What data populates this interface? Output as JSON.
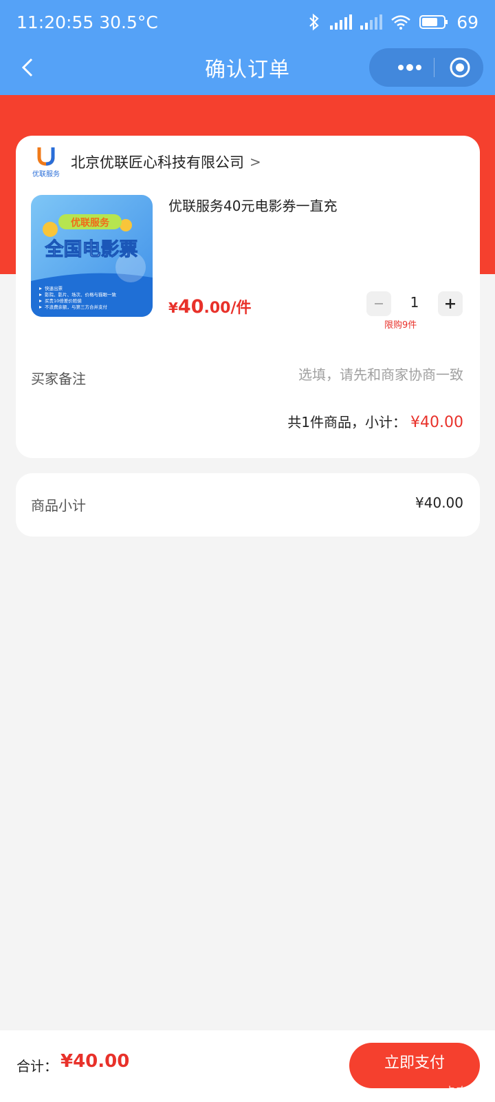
{
  "status_bar": {
    "time": "11:20:55",
    "temperature": "30.5°C",
    "battery": "69"
  },
  "nav": {
    "title": "确认订单"
  },
  "shop": {
    "logo_text": "优联服务",
    "name": "北京优联匠心科技有限公司",
    "chevron": ">"
  },
  "product": {
    "title": "优联服务40元电影券一直充",
    "price_currency": "¥",
    "price_int": "40",
    "price_dec": ".00/件",
    "quantity": "1",
    "limit": "限购9件",
    "thumb": {
      "badge": "优联服务",
      "headline": "全国电影票",
      "bullets": [
        "快速出票",
        "影院、影片、场次、价格与猫眼一致",
        "买贵10倍差价赔偿",
        "不浪费余额，与第三方合并支付"
      ]
    }
  },
  "remark": {
    "label": "买家备注",
    "placeholder": "选填，请先和商家协商一致"
  },
  "subtotal": {
    "label": "共1件商品，小计：",
    "amount": "¥40.00"
  },
  "goods_summary": {
    "label": "商品小计",
    "value": "¥40.00"
  },
  "footer": {
    "total_label": "合计：",
    "total_value": "¥40.00",
    "pay_label": "立即支付",
    "watermark": "卡农社区"
  },
  "colors": {
    "header_blue": "#55a2f7",
    "accent_red": "#f5402e",
    "price_red": "#e8312a"
  }
}
